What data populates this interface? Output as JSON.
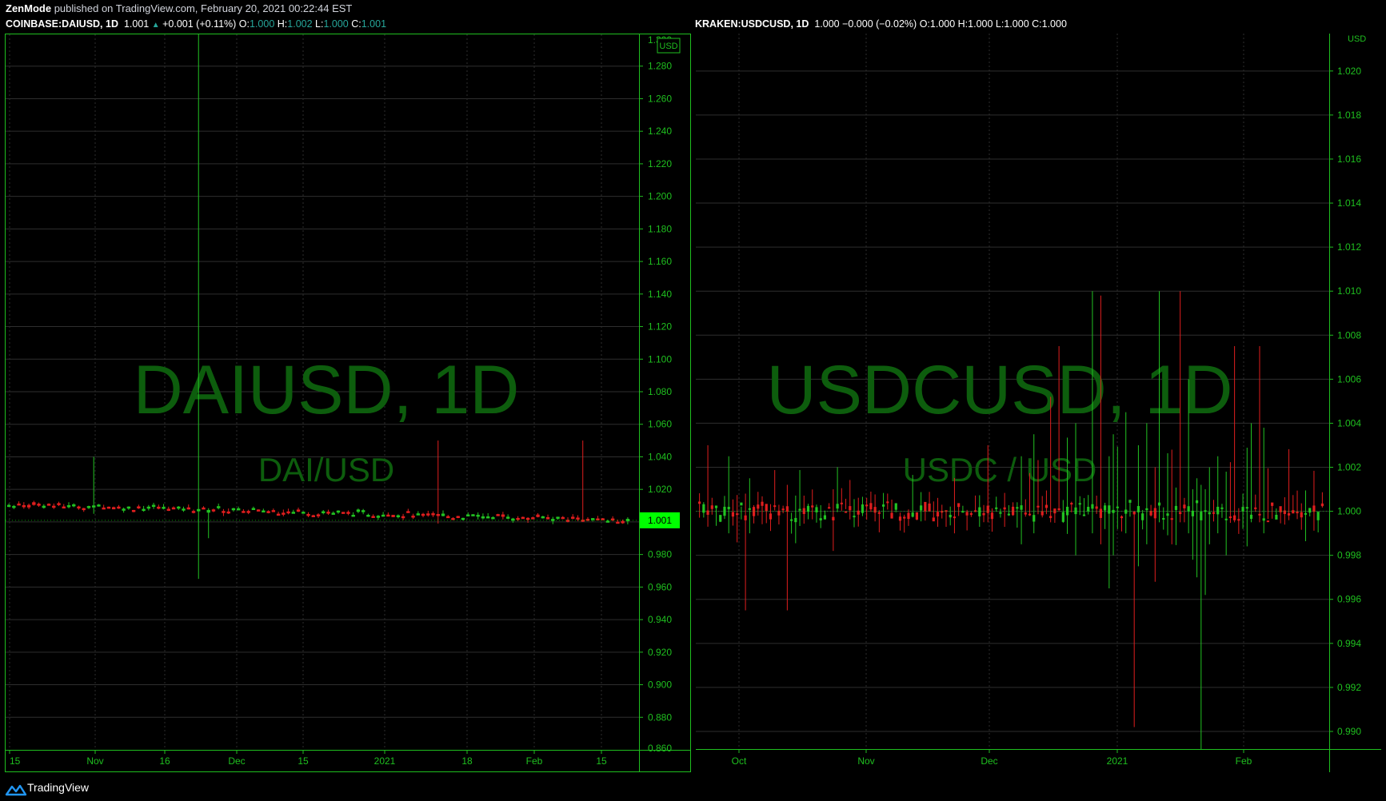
{
  "header": {
    "author": "ZenMode",
    "published_text": "published on TradingView.com, February 20, 2021 00:22:44 EST"
  },
  "left_chart": {
    "symbol": "COINBASE:DAIUSD, 1D",
    "last": "1.001",
    "change_arrow": "▲",
    "change": "+0.001 (+0.11%)",
    "o_label": "O:",
    "o": "1.000",
    "h_label": "H:",
    "h": "1.002",
    "l_label": "L:",
    "l": "1.000",
    "c_label": "C:",
    "c": "1.001",
    "watermark_title": "DAIUSD, 1D",
    "watermark_sub": "DAI/USD",
    "currency_badge": "USD",
    "price_badge": "1.001",
    "top_partial_tick": "1.300",
    "bottom_partial_tick": "0.860"
  },
  "right_chart": {
    "symbol": "KRAKEN:USDCUSD, 1D",
    "ohlc_text": "1.000 −0.000 (−0.02%)",
    "o_label": "O:",
    "o": "1.000",
    "h_label": "H:",
    "h": "1.000",
    "l_label": "L:",
    "l": "1.000",
    "c_label": "C:",
    "c": "1.000",
    "watermark_title": "USDCUSD, 1D",
    "watermark_sub": "USDC / USD",
    "currency_label": "USD"
  },
  "footer": {
    "brand": "TradingView",
    "logo_icon": "tradingview-logo-icon"
  },
  "colors": {
    "up": "#22c322",
    "down": "#e01e1e",
    "axis": "#1fbf1f",
    "watermark": "#0d5d0d",
    "grid": "#2e2e2e"
  },
  "chart_data": [
    {
      "type": "candlestick",
      "title": "DAIUSD, 1D",
      "ylim": [
        0.86,
        1.3
      ],
      "yticks": [
        0.88,
        0.9,
        0.92,
        0.94,
        0.96,
        0.98,
        1.0,
        1.02,
        1.04,
        1.06,
        1.08,
        1.1,
        1.12,
        1.14,
        1.16,
        1.18,
        1.2,
        1.22,
        1.24,
        1.26,
        1.28
      ],
      "ytick_labels": [
        "0.880",
        "0.900",
        "0.920",
        "0.940",
        "0.960",
        "0.980",
        "1.000",
        "1.020",
        "1.040",
        "1.060",
        "1.080",
        "1.100",
        "1.120",
        "1.140",
        "1.160",
        "1.180",
        "1.200",
        "1.220",
        "1.240",
        "1.260",
        "1.280"
      ],
      "xticks": [
        "15",
        "Nov",
        "16",
        "Dec",
        "15",
        "2021",
        "18",
        "Feb",
        "15"
      ],
      "spikes": [
        {
          "label": "Nov",
          "high": 1.04,
          "low": 1.005,
          "dir": "up"
        },
        {
          "label": "Nov-26",
          "high": 1.3,
          "low": 0.965,
          "dir": "up"
        },
        {
          "label": "Jan-12",
          "high": 1.05,
          "low": 0.999,
          "dir": "down"
        },
        {
          "label": "Feb-15",
          "high": 1.05,
          "low": 1.0,
          "dir": "down"
        }
      ],
      "series_start": 1.011,
      "series_end": 1.001
    },
    {
      "type": "candlestick",
      "title": "USDCUSD, 1D",
      "ylim": [
        0.9892,
        1.0217
      ],
      "yticks": [
        0.99,
        0.992,
        0.994,
        0.996,
        0.998,
        1.0,
        1.002,
        1.004,
        1.006,
        1.008,
        1.01,
        1.012,
        1.014,
        1.016,
        1.018,
        1.02
      ],
      "ytick_labels": [
        "0.990",
        "0.992",
        "0.994",
        "0.996",
        "0.998",
        "1.000",
        "1.002",
        "1.004",
        "1.006",
        "1.008",
        "1.010",
        "1.012",
        "1.014",
        "1.016",
        "1.018",
        "1.020"
      ],
      "xticks": [
        "Oct",
        "Nov",
        "Dec",
        "2021",
        "Feb"
      ],
      "baseline": 1.0
    }
  ]
}
